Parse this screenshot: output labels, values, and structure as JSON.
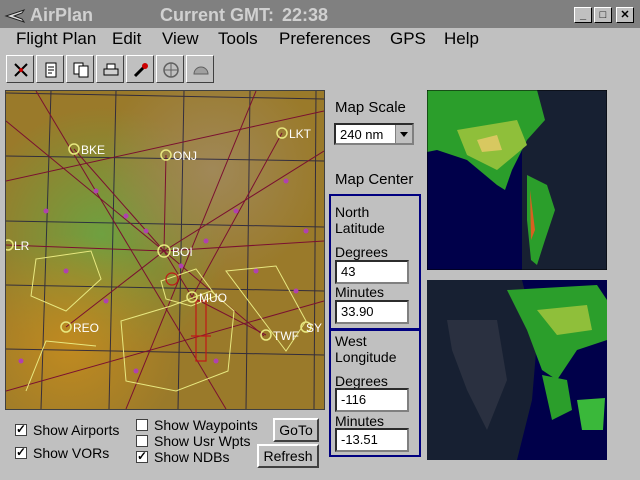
{
  "window": {
    "title": "AirPlan",
    "gmt_label": "Current GMT:",
    "gmt_value": "22:38",
    "controls": [
      "_",
      "□",
      "✕"
    ]
  },
  "menu": [
    "Flight Plan",
    "Edit",
    "View",
    "Tools",
    "Preferences",
    "GPS",
    "Help"
  ],
  "toolbar": {
    "icons": [
      "compass-icon",
      "new-doc-icon",
      "copy-doc-icon",
      "print-icon",
      "tools-icon",
      "globe-icon",
      "gauge-icon"
    ]
  },
  "map": {
    "waypoints": [
      "BKE",
      "ONJ",
      "LKT",
      "LR",
      "BOI",
      "MUO",
      "REO",
      "TWF",
      "SY"
    ],
    "colors": {
      "terrain": "#9a7a2a",
      "airway": "#7a1030",
      "airport": "#e8e880",
      "ndb": "#b040b0"
    }
  },
  "scale": {
    "label": "Map Scale",
    "value": "240 nm"
  },
  "center": {
    "label": "Map Center",
    "north_label": "North",
    "latitude_label": "Latitude",
    "lat_degrees_label": "Degrees",
    "lat_degrees": "43",
    "lat_minutes_label": "Minutes",
    "lat_minutes": "33.90",
    "west_label": "West",
    "longitude_label": "Longitude",
    "lon_degrees_label": "Degrees",
    "lon_degrees": "-116",
    "lon_minutes_label": "Minutes",
    "lon_minutes": "-13.51"
  },
  "options": {
    "airports": "Show Airports",
    "vors": "Show VORs",
    "waypoints": "Show Waypoints",
    "usr_wpts": "Show Usr Wpts",
    "ndbs": "Show NDBs"
  },
  "buttons": {
    "goto": "GoTo",
    "refresh": "Refresh"
  }
}
